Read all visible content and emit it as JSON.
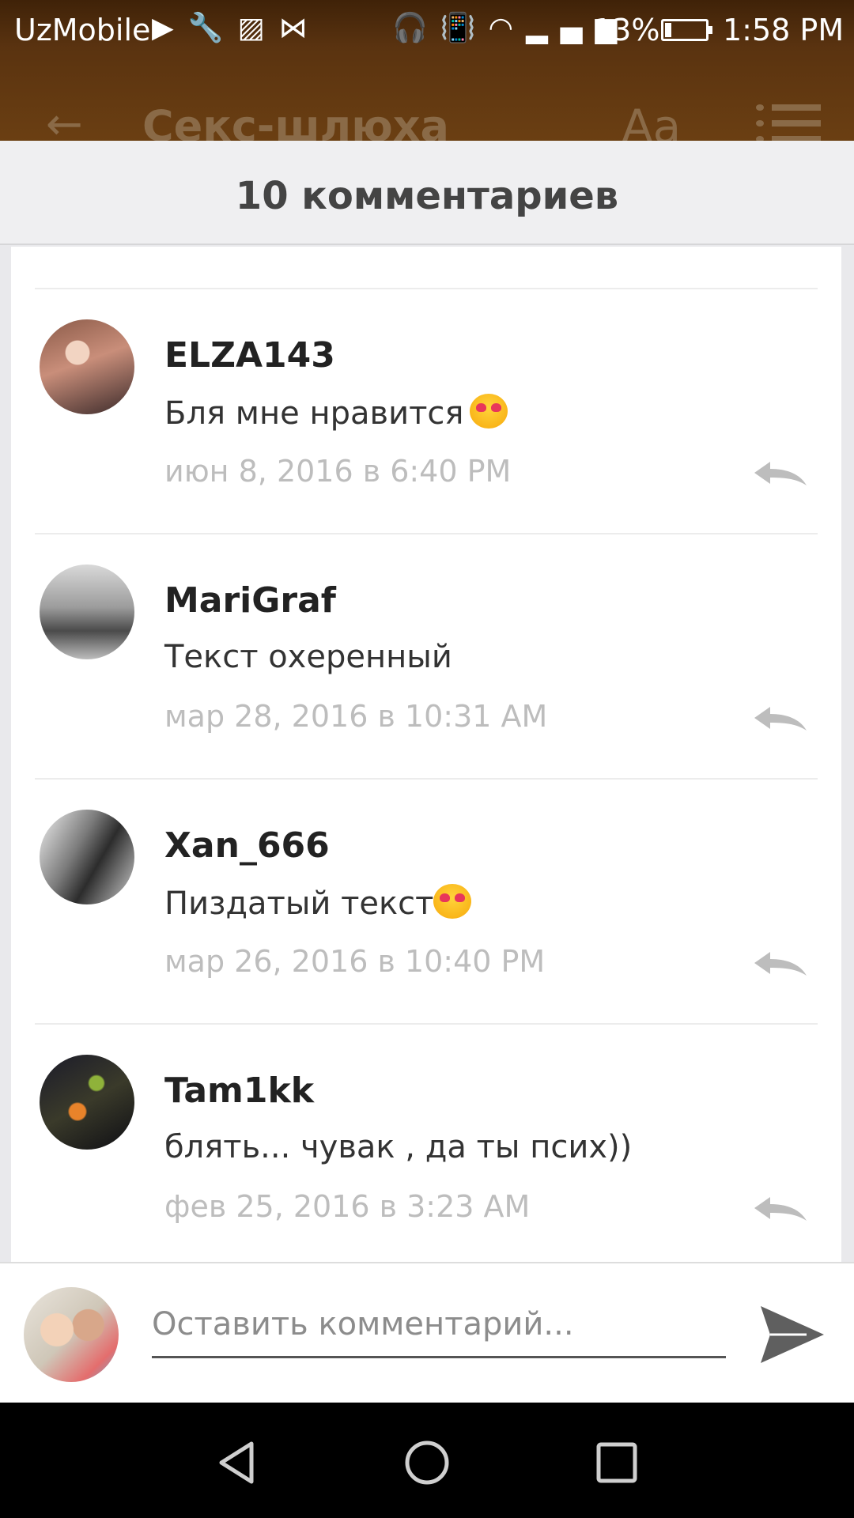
{
  "status_bar": {
    "carrier": "UzMobile",
    "notif_icons": [
      "play-icon",
      "wrench-icon",
      "image-icon",
      "bowtie-icon"
    ],
    "right_icons": [
      "headphones-icon",
      "vibrate-icon",
      "wifi-icon",
      "signal-icon"
    ],
    "battery": "13%",
    "time": "1:58 PM"
  },
  "app_bar": {
    "title": "Секс-шлюха",
    "font_button": "Aa"
  },
  "comments_sheet": {
    "title": "10 комментариев",
    "comments": [
      {
        "username": "ELZA143",
        "text": "Бля мне нравится",
        "emoji": "heart-eyes",
        "date": "июн 8, 2016 в 6:40 PM"
      },
      {
        "username": "MariGraf",
        "text": "Текст охеренный",
        "emoji": "",
        "date": "мар 28, 2016 в 10:31 AM"
      },
      {
        "username": "Xan_666",
        "text": "Пиздатый текст",
        "emoji": "heart-eyes",
        "date": "мар 26, 2016 в 10:40 PM"
      },
      {
        "username": "Tam1kk",
        "text": "блять... чувак , да ты псих))",
        "emoji": "",
        "date": "фев 25, 2016 в 3:23 AM"
      }
    ]
  },
  "composer": {
    "placeholder": "Оставить комментарий..."
  },
  "colors": {
    "app_bar": "#6b3f12",
    "muted_text": "#bdbdbd"
  }
}
